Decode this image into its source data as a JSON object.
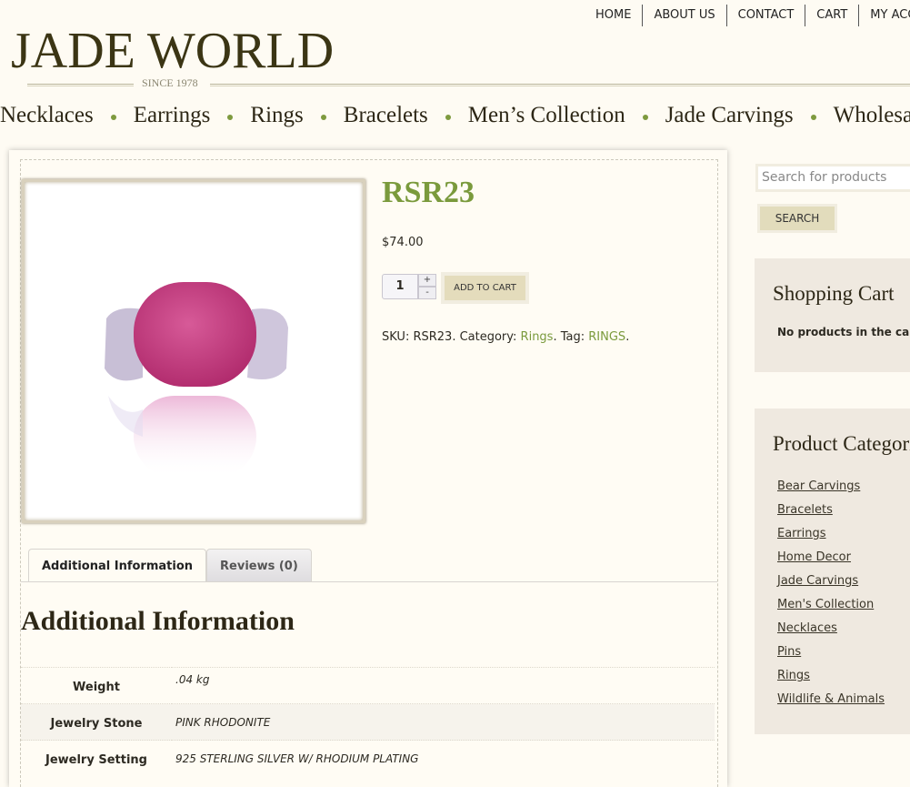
{
  "top_nav": [
    "HOME",
    "ABOUT US",
    "CONTACT",
    "CART",
    "MY ACCOUNT"
  ],
  "logo": {
    "name": "JADE WORLD",
    "tagline": "SINCE 1978"
  },
  "main_nav": [
    "Necklaces",
    "Earrings",
    "Rings",
    "Bracelets",
    "Men’s Collection",
    "Jade Carvings",
    "Wholesale"
  ],
  "product": {
    "title": "RSR23",
    "price": "$74.00",
    "quantity": "1",
    "plus": "+",
    "minus": "-",
    "add_to_cart": "ADD TO CART",
    "meta": {
      "sku_label": "SKU: ",
      "sku": "RSR23",
      "category_label": ". Category: ",
      "category": "Rings",
      "tag_label": ". Tag: ",
      "tag": "RINGS",
      "end": "."
    }
  },
  "tabs": [
    {
      "label": "Additional Information"
    },
    {
      "label": "Reviews (0)"
    }
  ],
  "additional": {
    "heading": "Additional Information",
    "rows": [
      {
        "key": "Weight",
        "value": ".04 kg"
      },
      {
        "key": "Jewelry Stone",
        "value": "PINK RHODONITE"
      },
      {
        "key": "Jewelry Setting",
        "value": "925 STERLING SILVER W/ RHODIUM PLATING"
      }
    ]
  },
  "sidebar": {
    "search_placeholder": "Search for products",
    "search_button": "SEARCH",
    "cart": {
      "title": "Shopping Cart",
      "empty": "No products in the cart."
    },
    "categories": {
      "title": "Product Categories",
      "items": [
        "Bear Carvings",
        "Bracelets",
        "Earrings",
        "Home Decor",
        "Jade Carvings",
        "Men's Collection",
        "Necklaces",
        "Pins",
        "Rings",
        "Wildlife & Animals"
      ]
    }
  },
  "colors": {
    "accent": "#7a9a3c",
    "background": "#fefbf3",
    "widget": "#efe9e0",
    "button": "#e4dcbc"
  }
}
